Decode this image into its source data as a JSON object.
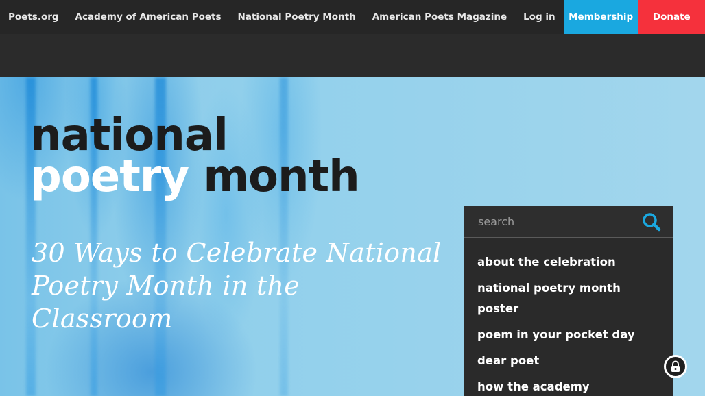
{
  "topnav": {
    "links": [
      {
        "label": "Poets.org"
      },
      {
        "label": "Academy of American Poets"
      },
      {
        "label": "National Poetry Month"
      },
      {
        "label": "American Poets Magazine"
      }
    ],
    "login_label": "Log in",
    "membership_label": "Membership",
    "donate_label": "Donate",
    "colors": {
      "membership": "#1aa8e0",
      "donate": "#f5313c",
      "nav_bg": "#262626"
    }
  },
  "hero": {
    "logo": {
      "line1": "national",
      "line2_word1": "poetry",
      "line2_word2": "month"
    },
    "headline": "30 Ways to Celebrate National Poetry Month in the Classroom"
  },
  "search": {
    "placeholder": "search",
    "icon": "search-icon",
    "icon_color": "#1aa8e0"
  },
  "menu": {
    "items": [
      {
        "label": "about the celebration"
      },
      {
        "label": "national poetry month poster"
      },
      {
        "label": "poem in your pocket day"
      },
      {
        "label": "dear poet"
      },
      {
        "label": "how the academy"
      }
    ]
  },
  "badge": {
    "icon": "lock-icon"
  }
}
